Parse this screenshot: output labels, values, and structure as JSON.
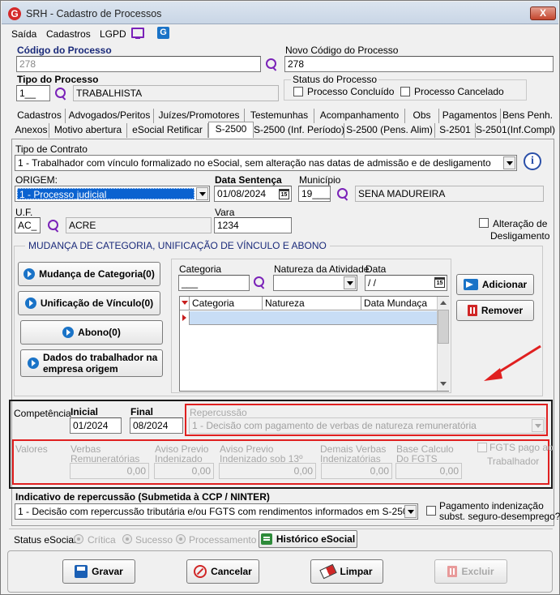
{
  "window": {
    "title": "SRH - Cadastro de Processos",
    "close": "X"
  },
  "menu": [
    "Saída",
    "Cadastros",
    "LGPD"
  ],
  "header": {
    "codigo_label": "Código do Processo",
    "codigo_value": "278",
    "novo_codigo_label": "Novo Código do Processo",
    "novo_codigo_value": "278",
    "tipo_label": "Tipo do Processo",
    "tipo_code": "1__",
    "tipo_desc": "TRABALHISTA",
    "status_label": "Status do Processo",
    "status_concluido": "Processo Concluído",
    "status_cancelado": "Processo Cancelado"
  },
  "tabs_row1": [
    "Cadastros",
    "Advogados/Peritos",
    "Juízes/Promotores",
    "Testemunhas",
    "Acompanhamento",
    "Obs",
    "Pagamentos",
    "Bens Penh."
  ],
  "tabs_row2": [
    "Anexos",
    "Motivo abertura",
    "eSocial Retificar",
    "S-2500",
    "S-2500 (Inf. Período)",
    "S-2500 (Pens. Alim)",
    "S-2501",
    "S-2501(Inf.Compl)"
  ],
  "form": {
    "tipo_contrato_label": "Tipo de Contrato",
    "tipo_contrato_value": "1 - Trabalhador com vínculo formalizado no eSocial, sem alteração nas datas de admissão e de desligamento",
    "origem_label": "ORIGEM:",
    "origem_value": "1 - Processo judicial",
    "data_sentenca_label": "Data Sentença",
    "data_sentenca_value": "01/08/2024",
    "municipio_label": "Município",
    "municipio_code": "19____",
    "municipio_name": "SENA MADUREIRA",
    "uf_label": "U.F.",
    "uf_code": "AC_",
    "uf_name": "ACRE",
    "vara_label": "Vara",
    "vara_value": "1234",
    "alteracao_label_1": "Alteração de",
    "alteracao_label_2": "Desligamento"
  },
  "mudanca": {
    "legend": "MUDANÇA DE CATEGORIA, UNIFICAÇÃO DE VÍNCULO E ABONO",
    "btn_mudanca": "Mudança de Categoria(0)",
    "btn_unificacao": "Unificação de Vínculo(0)",
    "btn_abono": "Abono(0)",
    "btn_dados_1": "Dados do trabalhador na",
    "btn_dados_2": "empresa origem",
    "categoria_label": "Categoria",
    "categoria_value": "___",
    "natureza_label": "Natureza da Atividade",
    "data_label": "Data",
    "data_value": " /  /",
    "btn_adicionar": "Adicionar",
    "btn_remover": "Remover",
    "grid_headers": [
      "Categoria",
      "Natureza",
      "Data Mundaça"
    ]
  },
  "competencia": {
    "label": "Competência",
    "inicial_label": "Inicial",
    "inicial_value": "01/2024",
    "final_label": "Final",
    "final_value": "08/2024",
    "repercussao_label": "Repercussão",
    "repercussao_value": "1 - Decisão com pagamento de verbas de natureza remuneratória"
  },
  "valores": {
    "label": "Valores",
    "verbas_1": "Verbas",
    "verbas_2": "Remuneratórias",
    "verbas_value": "0,00",
    "aviso_1": "Aviso Previo",
    "aviso_2": "Indenizado",
    "aviso_value": "0,00",
    "aviso13_1": "Aviso Previo",
    "aviso13_2": "Indenizado sob 13º",
    "aviso13_value": "0,00",
    "demais_1": "Demais Verbas",
    "demais_2": "Indenizatórias",
    "demais_value": "0,00",
    "base_1": "Base Calculo",
    "base_2": "Do FGTS",
    "base_value": "0,00",
    "fgts_1": "FGTS pago ao",
    "fgts_2": "Trabalhador"
  },
  "indicativo": {
    "label": "Indicativo de repercussão (Submetida à CCP / NINTER)",
    "value": "1 - Decisão com repercussão tributária e/ou FGTS com rendimentos informados em S-2501",
    "pagamento_1": "Pagamento indenização",
    "pagamento_2": "subst. seguro-desemprego?"
  },
  "status_esocial": {
    "label": "Status eSocial:",
    "options": [
      "Crítica",
      "Sucesso",
      "Processamento"
    ],
    "historico": "Histórico eSocial"
  },
  "actions": {
    "gravar": "Gravar",
    "cancelar": "Cancelar",
    "limpar": "Limpar",
    "excluir": "Excluir"
  },
  "colors": {
    "annotation_red": "#e02020",
    "selection_blue": "#0a62d0",
    "label_navy": "#1a2a7a"
  }
}
